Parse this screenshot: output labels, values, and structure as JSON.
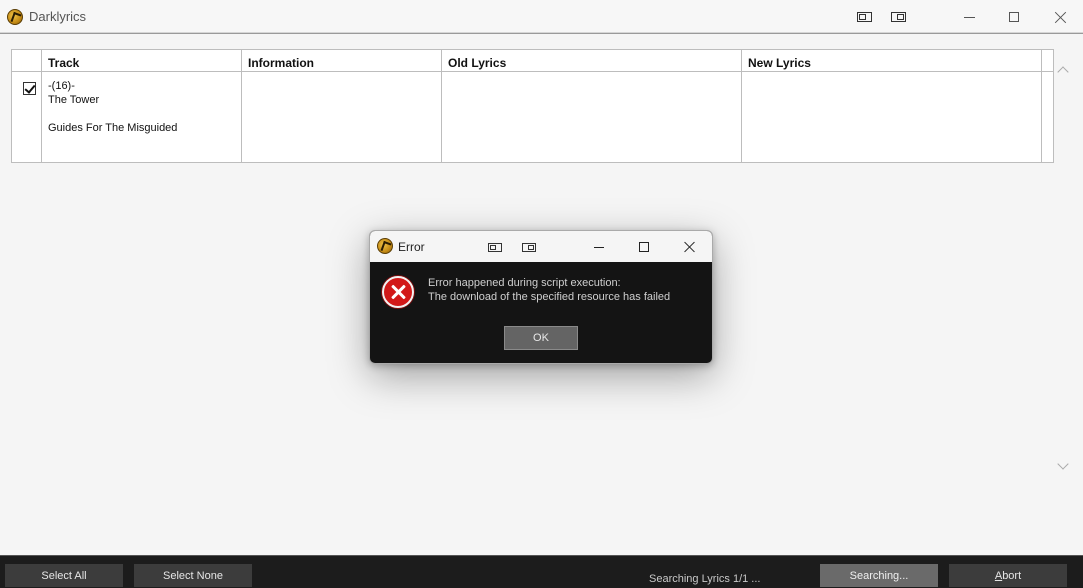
{
  "window": {
    "title": "Darklyrics",
    "controls": {
      "layout_left": "layout-left-icon",
      "layout_right": "layout-right-icon",
      "minimize": "minimize-icon",
      "maximize": "maximize-icon",
      "close": "close-icon"
    }
  },
  "grid": {
    "columns": [
      "Track",
      "Information",
      "Old Lyrics",
      "New Lyrics"
    ],
    "rows": [
      {
        "checked": true,
        "track_lines": [
          "-(16)-",
          "The Tower",
          "",
          "Guides For The Misguided"
        ],
        "information": "",
        "old_lyrics": "",
        "new_lyrics": ""
      }
    ]
  },
  "dialog": {
    "title": "Error",
    "message_line1": "Error happened during script execution:",
    "message_line2": "The download of the specified resource has failed",
    "ok_label": "OK",
    "icon": "error-icon"
  },
  "footer": {
    "select_all": "Select All",
    "select_none": "Select None",
    "status": "Searching Lyrics  1/1 ...",
    "searching": "Searching...",
    "abort": "Abort"
  }
}
